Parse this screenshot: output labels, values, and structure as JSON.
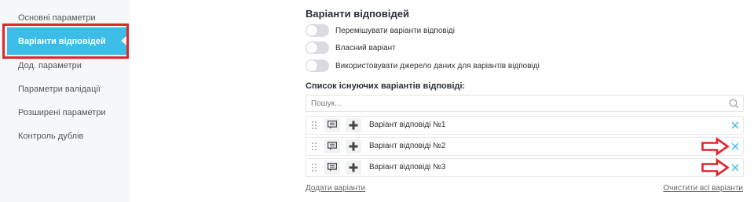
{
  "sidebar": {
    "items": [
      {
        "label": "Основні параметри"
      },
      {
        "label": "Варіанти відповідей"
      },
      {
        "label": "Дод. параметри"
      },
      {
        "label": "Параметри валідації"
      },
      {
        "label": "Розширені параметри"
      },
      {
        "label": "Контроль дублів"
      }
    ],
    "active_index": 1
  },
  "main": {
    "title": "Варіанти відповідей",
    "toggles": [
      {
        "label": "Перемішувати варіанти відповіді",
        "on": false
      },
      {
        "label": "Власний варіант",
        "on": false
      },
      {
        "label": "Використовувати джерело даних для варіантів відповіді",
        "on": false
      }
    ],
    "list_title": "Список існуючих варіантів відповіді:",
    "search": {
      "placeholder": "Пошук...",
      "value": ""
    },
    "options": [
      {
        "label": "Варіант відповіді №1"
      },
      {
        "label": "Варіант відповіді №2"
      },
      {
        "label": "Варіант відповіді №3"
      }
    ],
    "add_link": "Додати варіанти",
    "clear_link": "Очистити всі варіанти"
  },
  "colors": {
    "accent": "#3bbde8",
    "highlight": "#e0252b",
    "remove": "#3bbde8"
  },
  "icons": [
    "search-icon",
    "drag-handle-icon",
    "comment-icon",
    "plus-icon",
    "close-icon"
  ]
}
